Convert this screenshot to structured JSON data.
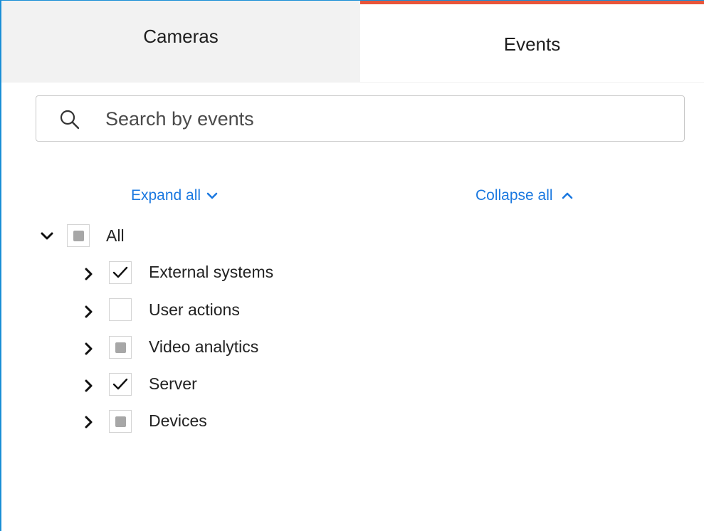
{
  "tabs": {
    "cameras_label": "Cameras",
    "events_label": "Events"
  },
  "search": {
    "placeholder": "Search by events",
    "value": ""
  },
  "controls": {
    "expand_all_label": "Expand all",
    "collapse_all_label": "Collapse all"
  },
  "tree": {
    "root": {
      "label": "All",
      "state": "partial",
      "expanded": true
    },
    "items": [
      {
        "label": "External systems",
        "state": "checked",
        "expanded": false
      },
      {
        "label": "User actions",
        "state": "unchecked",
        "expanded": false
      },
      {
        "label": "Video analytics",
        "state": "partial",
        "expanded": false
      },
      {
        "label": "Server",
        "state": "checked",
        "expanded": false
      },
      {
        "label": "Devices",
        "state": "partial",
        "expanded": false
      }
    ]
  },
  "colors": {
    "active_tab_accent": "#e8553a",
    "link": "#1a78e0",
    "window_border": "#1a8fd6",
    "partial_check": "#a7a7a7"
  },
  "icons": {
    "search": "magnifier-icon",
    "expand": "chevron-down-icon",
    "collapse": "chevron-up-icon",
    "tree_expanded": "chevron-down-icon",
    "tree_collapsed": "chevron-right-icon",
    "checked": "checkmark-icon"
  }
}
